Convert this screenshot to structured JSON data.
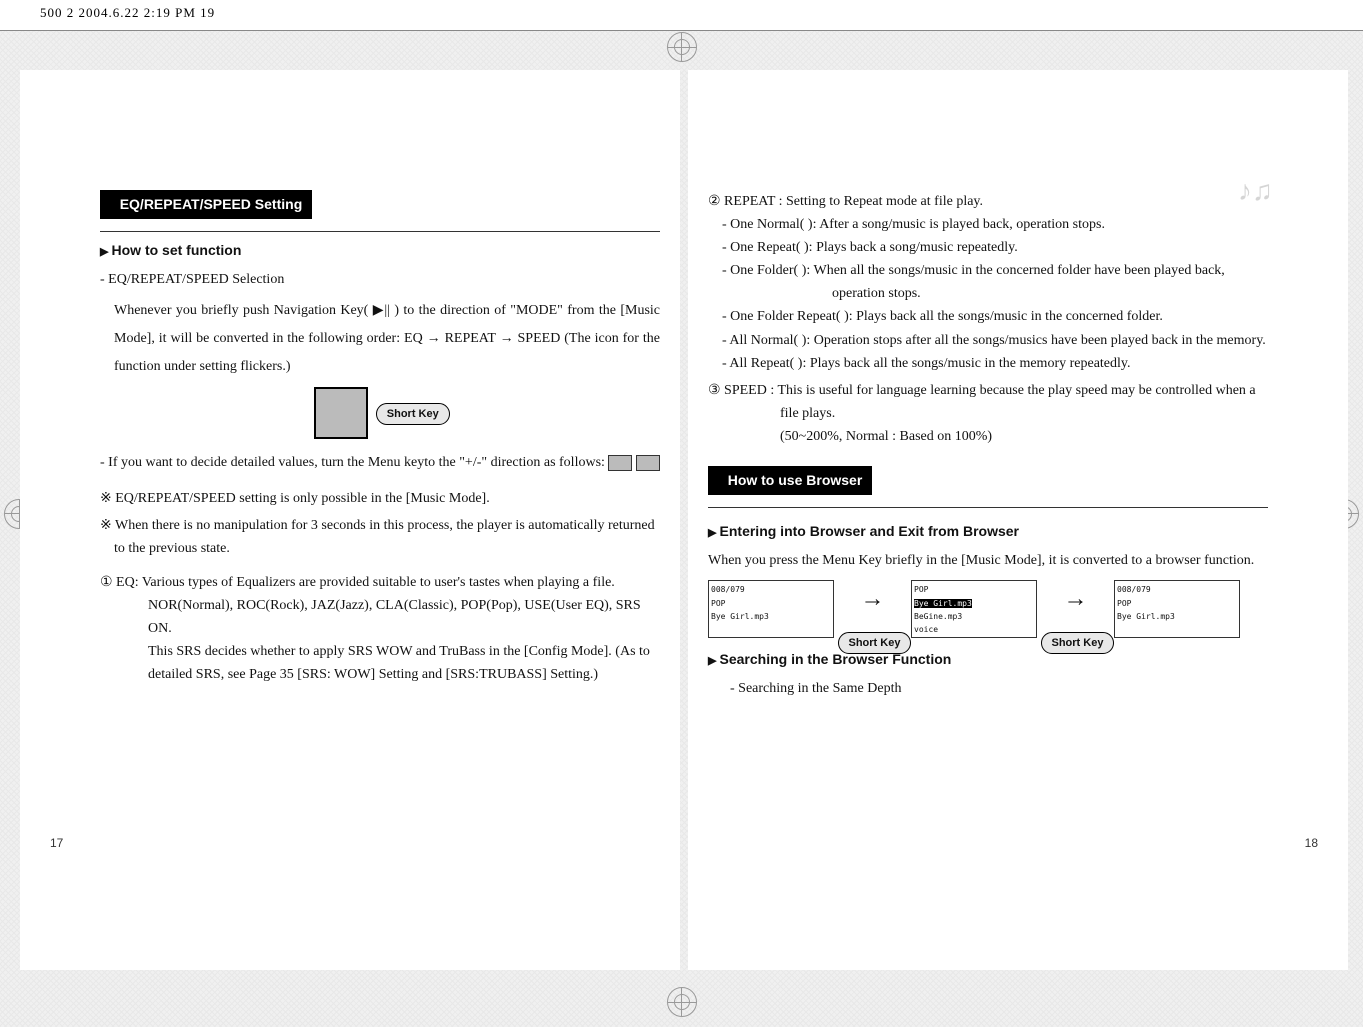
{
  "meta_strip": "500            2  2004.6.22 2:19 PM           19",
  "left": {
    "section_title": "EQ/REPEAT/SPEED Setting",
    "sub1": "How to set function",
    "sel_label": "- EQ/REPEAT/SPEED Selection",
    "p1": "Whenever you briefly push Navigation Key( ▶|| ) to the direction of \"MODE\" from the [Music Mode], it will be converted in the following order: EQ → REPEAT → SPEED (The icon for the function under setting flickers.)",
    "shortkey": "Short Key",
    "p2": "- If you want to decide detailed values, turn the Menu keyto the \"+/-\" direction as follows:",
    "note1": "※ EQ/REPEAT/SPEED setting is only possible in the [Music Mode].",
    "note2": "※ When there is no manipulation for 3 seconds in this process, the player is automatically returned to the previous state.",
    "item1a": "① EQ: Various types of Equalizers are provided suitable to user's tastes when playing a file.",
    "item1b": "NOR(Normal), ROC(Rock), JAZ(Jazz), CLA(Classic), POP(Pop), USE(User EQ), SRS ON.",
    "item1c": "This SRS decides whether to apply SRS WOW and TruBass in the [Config Mode]. (As to detailed SRS, see Page 35 [SRS: WOW] Setting and [SRS:TRUBASS] Setting.)",
    "pagenum": "17"
  },
  "right": {
    "item2": "② REPEAT : Setting to Repeat mode at file play.",
    "r1": "- One Normal(       ): After a song/music is played back, operation stops.",
    "r2": "- One Repeat(       ): Plays back a song/music repeatedly.",
    "r3": "- One Folder(       ): When all the songs/music in the concerned folder have been played back, operation stops.",
    "r4": "- One Folder Repeat(       ): Plays back all the songs/music in the concerned folder.",
    "r5": "- All Normal(       ): Operation stops after all the songs/musics have been played back in the memory.",
    "r6": "- All Repeat(       ): Plays back all the songs/music in the memory repeatedly.",
    "item3": "③ SPEED : This is useful for language learning because the play speed may be controlled when a file plays.",
    "item3b": "(50~200%, Normal : Based on 100%)",
    "section_title": "How to use Browser",
    "sub1": "Entering into Browser and Exit from Browser",
    "p1": "When you press the Menu Key briefly in the [Music Mode], it is converted to a browser function.",
    "shortkey": "Short Key",
    "sub2": "Searching in the Browser Function",
    "p2": "- Searching in the Same Depth",
    "lcd1_l1": "008/079",
    "lcd1_l2": "POP",
    "lcd1_l3": "Bye Girl.mp3",
    "lcd2_l1": "POP",
    "lcd2_l2": "Bye Girl.mp3",
    "lcd2_l3": "BeGine.mp3",
    "lcd2_l4": "voice",
    "lcd3_l1": "008/079",
    "lcd3_l2": "POP",
    "lcd3_l3": "Bye Girl.mp3",
    "pagenum": "18"
  }
}
